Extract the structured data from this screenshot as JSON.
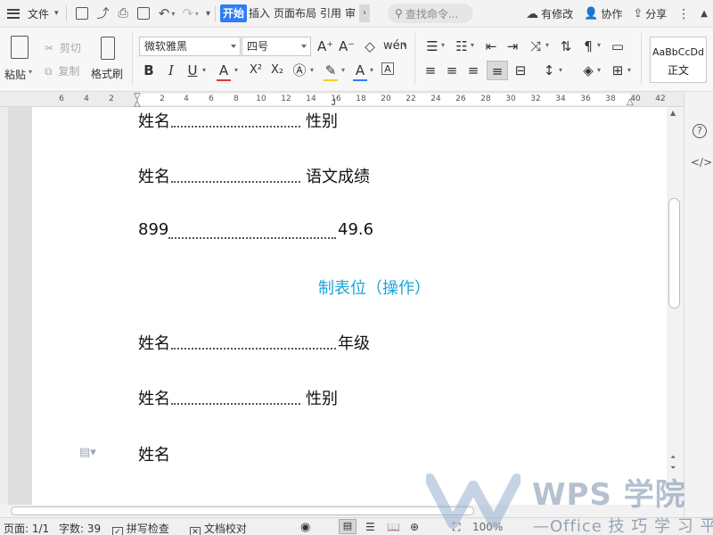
{
  "menubar": {
    "file_label": "文件",
    "tabs": [
      "开始",
      "插入",
      "页面布局",
      "引用",
      "审"
    ],
    "search_placeholder": "查找命令...",
    "has_changes_label": "有修改",
    "collaborate_label": "协作",
    "share_label": "分享"
  },
  "ribbon": {
    "paste_label": "粘贴",
    "cut_label": "剪切",
    "copy_label": "复制",
    "format_painter_label": "格式刷",
    "font_name": "微软雅黑",
    "font_size": "四号",
    "bold": "B",
    "italic": "I",
    "underline": "U",
    "superscript": "X²",
    "subscript": "X₂",
    "style_preview": "AaBbCcDd",
    "style_name": "正文",
    "colors": {
      "font_color": "#e53935",
      "highlight": "#f7d21c",
      "accent": "#2f7cf6"
    }
  },
  "ruler": {
    "left_numbers": [
      "6",
      "4",
      "2"
    ],
    "numbers": [
      "2",
      "4",
      "6",
      "8",
      "10",
      "12",
      "14",
      "16",
      "18",
      "20",
      "22",
      "24",
      "26",
      "28",
      "30",
      "32",
      "34",
      "36",
      "38",
      "40",
      "42"
    ]
  },
  "document": {
    "lines": [
      {
        "left": "姓名",
        "right": "性别"
      },
      {
        "left": "姓名",
        "right": "语文成绩"
      },
      {
        "left": "899",
        "right": "49.6"
      },
      {
        "heading": "制表位（操作）"
      },
      {
        "left": "姓名",
        "right": "年级"
      },
      {
        "left": "姓名",
        "right": "性别"
      },
      {
        "left": "姓名"
      }
    ]
  },
  "statusbar": {
    "page": "页面: 1/1",
    "word_count": "字数: 39",
    "spell_check": "拼写检查",
    "doc_proof": "文档校对",
    "zoom": "100%"
  },
  "watermark": {
    "brand": "WPS 学院",
    "slogan": "—Office 技 巧 学 习 平 台"
  }
}
